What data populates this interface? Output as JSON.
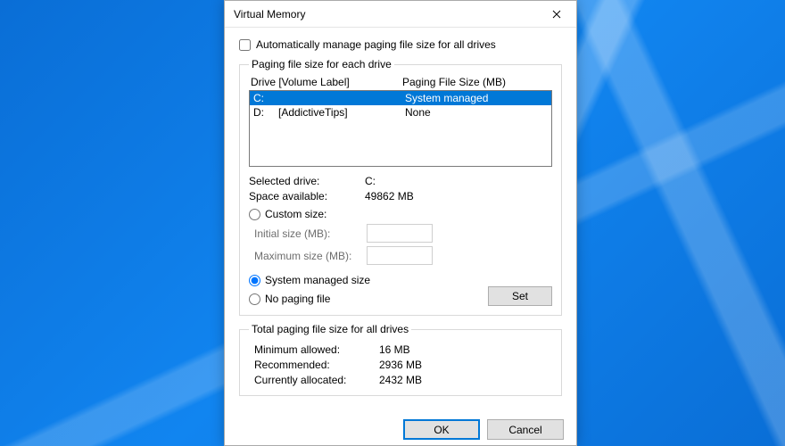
{
  "window": {
    "title": "Virtual Memory",
    "close_icon": "close-icon"
  },
  "auto_manage": {
    "label": "Automatically manage paging file size for all drives",
    "checked": false
  },
  "group1": {
    "legend": "Paging file size for each drive",
    "header_drive": "Drive  [Volume Label]",
    "header_size": "Paging File Size (MB)",
    "drives": [
      {
        "letter": "C:",
        "label": "",
        "size": "System managed",
        "selected": true
      },
      {
        "letter": "D:",
        "label": "[AddictiveTips]",
        "size": "None",
        "selected": false
      }
    ],
    "selected_drive_label": "Selected drive:",
    "selected_drive_value": "C:",
    "space_available_label": "Space available:",
    "space_available_value": "49862 MB",
    "custom_size_label": "Custom size:",
    "initial_size_label": "Initial size (MB):",
    "initial_size_value": "",
    "maximum_size_label": "Maximum size (MB):",
    "maximum_size_value": "",
    "system_managed_label": "System managed size",
    "no_paging_label": "No paging file",
    "selected_radio": "system_managed",
    "set_button": "Set"
  },
  "group2": {
    "legend": "Total paging file size for all drives",
    "min_allowed_label": "Minimum allowed:",
    "min_allowed_value": "16 MB",
    "recommended_label": "Recommended:",
    "recommended_value": "2936 MB",
    "currently_allocated_label": "Currently allocated:",
    "currently_allocated_value": "2432 MB"
  },
  "footer": {
    "ok": "OK",
    "cancel": "Cancel"
  }
}
